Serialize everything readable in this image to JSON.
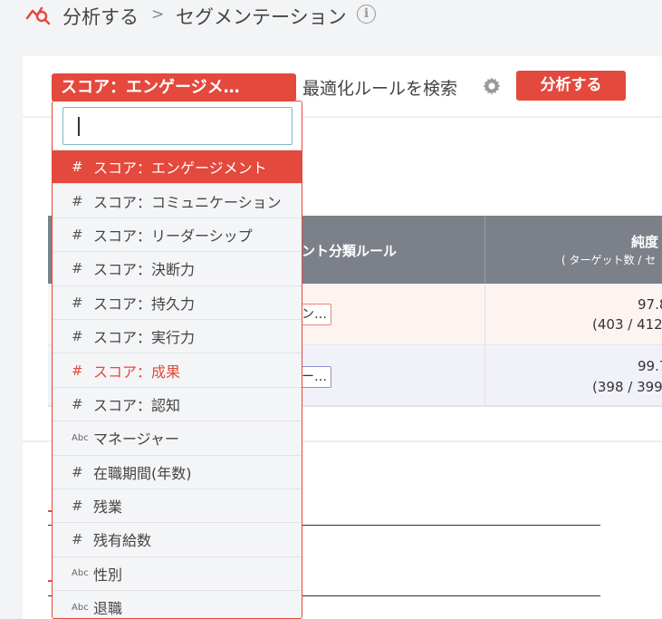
{
  "breadcrumb": {
    "root": "分析する",
    "separator": ">",
    "current": "セグメンテーション"
  },
  "toolbar": {
    "selected_variable": "スコア：エンゲージメ…",
    "search_label": "最適化ルールを検索",
    "analyze_label": "分析する"
  },
  "table": {
    "col_rule": "ント分類ルール",
    "col_purity": "純度",
    "col_purity_sub": "( ターゲット数 / セ",
    "rows": [
      {
        "tag": "ン…",
        "value": "97.8",
        "ratio": "(403 / 412"
      },
      {
        "tag": "ー…",
        "value": "99.7",
        "ratio": "(398 / 399"
      }
    ]
  },
  "dropdown": {
    "search_value": "",
    "items": [
      {
        "icon": "#",
        "label": "スコア：エンゲージメント"
      },
      {
        "icon": "#",
        "label": "スコア：コミュニケーション"
      },
      {
        "icon": "#",
        "label": "スコア：リーダーシップ"
      },
      {
        "icon": "#",
        "label": "スコア：決断力"
      },
      {
        "icon": "#",
        "label": "スコア：持久力"
      },
      {
        "icon": "#",
        "label": "スコア：実行力"
      },
      {
        "icon": "#",
        "label": "スコア：成果"
      },
      {
        "icon": "#",
        "label": "スコア：認知"
      },
      {
        "icon": "Abc",
        "label": "マネージャー"
      },
      {
        "icon": "#",
        "label": "在職期間(年数)"
      },
      {
        "icon": "#",
        "label": "残業"
      },
      {
        "icon": "#",
        "label": "残有給数"
      },
      {
        "icon": "Abc",
        "label": "性別"
      },
      {
        "icon": "Abc",
        "label": "退職"
      }
    ]
  },
  "colors": {
    "accent": "#e3493c",
    "header_gray": "#7c8089"
  }
}
